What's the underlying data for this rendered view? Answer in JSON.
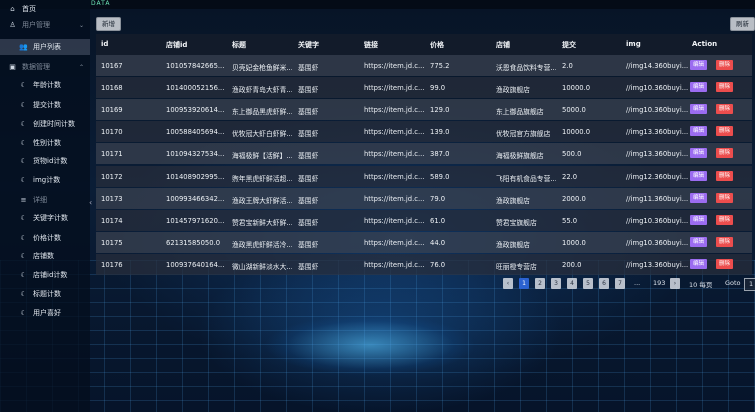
{
  "topbar": {
    "tag": "DATA"
  },
  "sidebar": {
    "items": [
      {
        "label": "首页",
        "icon": "home-icon",
        "glyph": "⌂",
        "kind": "top"
      },
      {
        "label": "用户管理",
        "icon": "user-icon",
        "glyph": "♙",
        "kind": "group"
      },
      {
        "label": "用户列表",
        "icon": "users-icon",
        "glyph": "👥",
        "kind": "active"
      },
      {
        "label": "数据管理",
        "icon": "data-icon",
        "glyph": "▣",
        "kind": "groupdim"
      },
      {
        "label": "年龄计数",
        "icon": "moon-icon",
        "glyph": "☾",
        "kind": "sub"
      },
      {
        "label": "提交计数",
        "icon": "moon-icon",
        "glyph": "☾",
        "kind": "sub"
      },
      {
        "label": "创建时间计数",
        "icon": "moon-icon",
        "glyph": "☾",
        "kind": "sub"
      },
      {
        "label": "性别计数",
        "icon": "moon-icon",
        "glyph": "☾",
        "kind": "sub"
      },
      {
        "label": "货物id计数",
        "icon": "moon-icon",
        "glyph": "☾",
        "kind": "sub"
      },
      {
        "label": "img计数",
        "icon": "moon-icon",
        "glyph": "☾",
        "kind": "sub"
      },
      {
        "label": "详细",
        "icon": "list-icon",
        "glyph": "≡",
        "kind": "dim"
      },
      {
        "label": "关键字计数",
        "icon": "moon-icon",
        "glyph": "☾",
        "kind": "sub"
      },
      {
        "label": "价格计数",
        "icon": "moon-icon",
        "glyph": "☾",
        "kind": "sub"
      },
      {
        "label": "店铺数",
        "icon": "moon-icon",
        "glyph": "☾",
        "kind": "sub"
      },
      {
        "label": "店铺id计数",
        "icon": "moon-icon",
        "glyph": "☾",
        "kind": "sub"
      },
      {
        "label": "标题计数",
        "icon": "moon-icon",
        "glyph": "☾",
        "kind": "sub"
      },
      {
        "label": "用户喜好",
        "icon": "moon-icon",
        "glyph": "☾",
        "kind": "sub"
      }
    ]
  },
  "toolbar": {
    "add_label": "新增",
    "refresh_label": "刷新"
  },
  "table": {
    "columns": [
      "id",
      "店铺id",
      "标题",
      "关键字",
      "链接",
      "价格",
      "店铺",
      "提交",
      "img",
      "Action"
    ],
    "edit_label": "编辑",
    "delete_label": "删除",
    "rows": [
      [
        "10167",
        "101057842665...",
        "贝壳妃金枪鱼鲜米...",
        "基围虾",
        "https://item.jd.c...",
        "775.2",
        "沃恩食品饮料专营...",
        "2.0",
        "//img14.360buyi..."
      ],
      [
        "10168",
        "101400052156...",
        "渔政虾青岛大虾青...",
        "基围虾",
        "https://item.jd.c...",
        "99.0",
        "渔政旗舰店",
        "10000.0",
        "//img10.360buyi..."
      ],
      [
        "10169",
        "100953920614...",
        "东上御品黑虎虾鲜...",
        "基围虾",
        "https://item.jd.c...",
        "129.0",
        "东上御品旗舰店",
        "5000.0",
        "//img10.360buyi..."
      ],
      [
        "10170",
        "100588405694...",
        "优牧冠大虾白虾鲜...",
        "基围虾",
        "https://item.jd.c...",
        "139.0",
        "优牧冠官方旗舰店",
        "10000.0",
        "//img13.360buyi..."
      ],
      [
        "10171",
        "101094327534...",
        "海福极鲜【活鲜】...",
        "基围虾",
        "https://item.jd.c...",
        "387.0",
        "海福极鲜旗舰店",
        "500.0",
        "//img13.360buyi..."
      ],
      [
        "10172",
        "101408902995...",
        "煦年黑虎虾鲜活超...",
        "基围虾",
        "https://item.jd.c...",
        "589.0",
        "飞阳有机食品专营...",
        "22.0",
        "//img12.360buyi..."
      ],
      [
        "10173",
        "100993466342...",
        "渔政王牌大虾鲜活...",
        "基围虾",
        "https://item.jd.c...",
        "79.0",
        "渔政旗舰店",
        "2000.0",
        "//img11.360buyi..."
      ],
      [
        "10174",
        "101457971620...",
        "赞君宝新鲜大虾鲜...",
        "基围虾",
        "https://item.jd.c...",
        "61.0",
        "赞君宝旗舰店",
        "55.0",
        "//img10.360buyi..."
      ],
      [
        "10175",
        "62131585050.0",
        "渔政黑虎虾鲜活冷...",
        "基围虾",
        "https://item.jd.c...",
        "44.0",
        "渔政旗舰店",
        "1000.0",
        "//img10.360buyi..."
      ],
      [
        "10176",
        "100937640164...",
        "微山湖新鲜淡水大...",
        "基围虾",
        "https://item.jd.c...",
        "76.0",
        "旺丽橙专营店",
        "200.0",
        "//img13.360buyi..."
      ]
    ]
  },
  "pagination": {
    "prev": "‹",
    "pages": [
      "1",
      "2",
      "3",
      "4",
      "5",
      "6",
      "7"
    ],
    "current": "1",
    "ellipsis": "...",
    "last": "193",
    "next": "›",
    "page_size": "10 每页",
    "goto_label": "Goto",
    "goto_value": "1"
  }
}
